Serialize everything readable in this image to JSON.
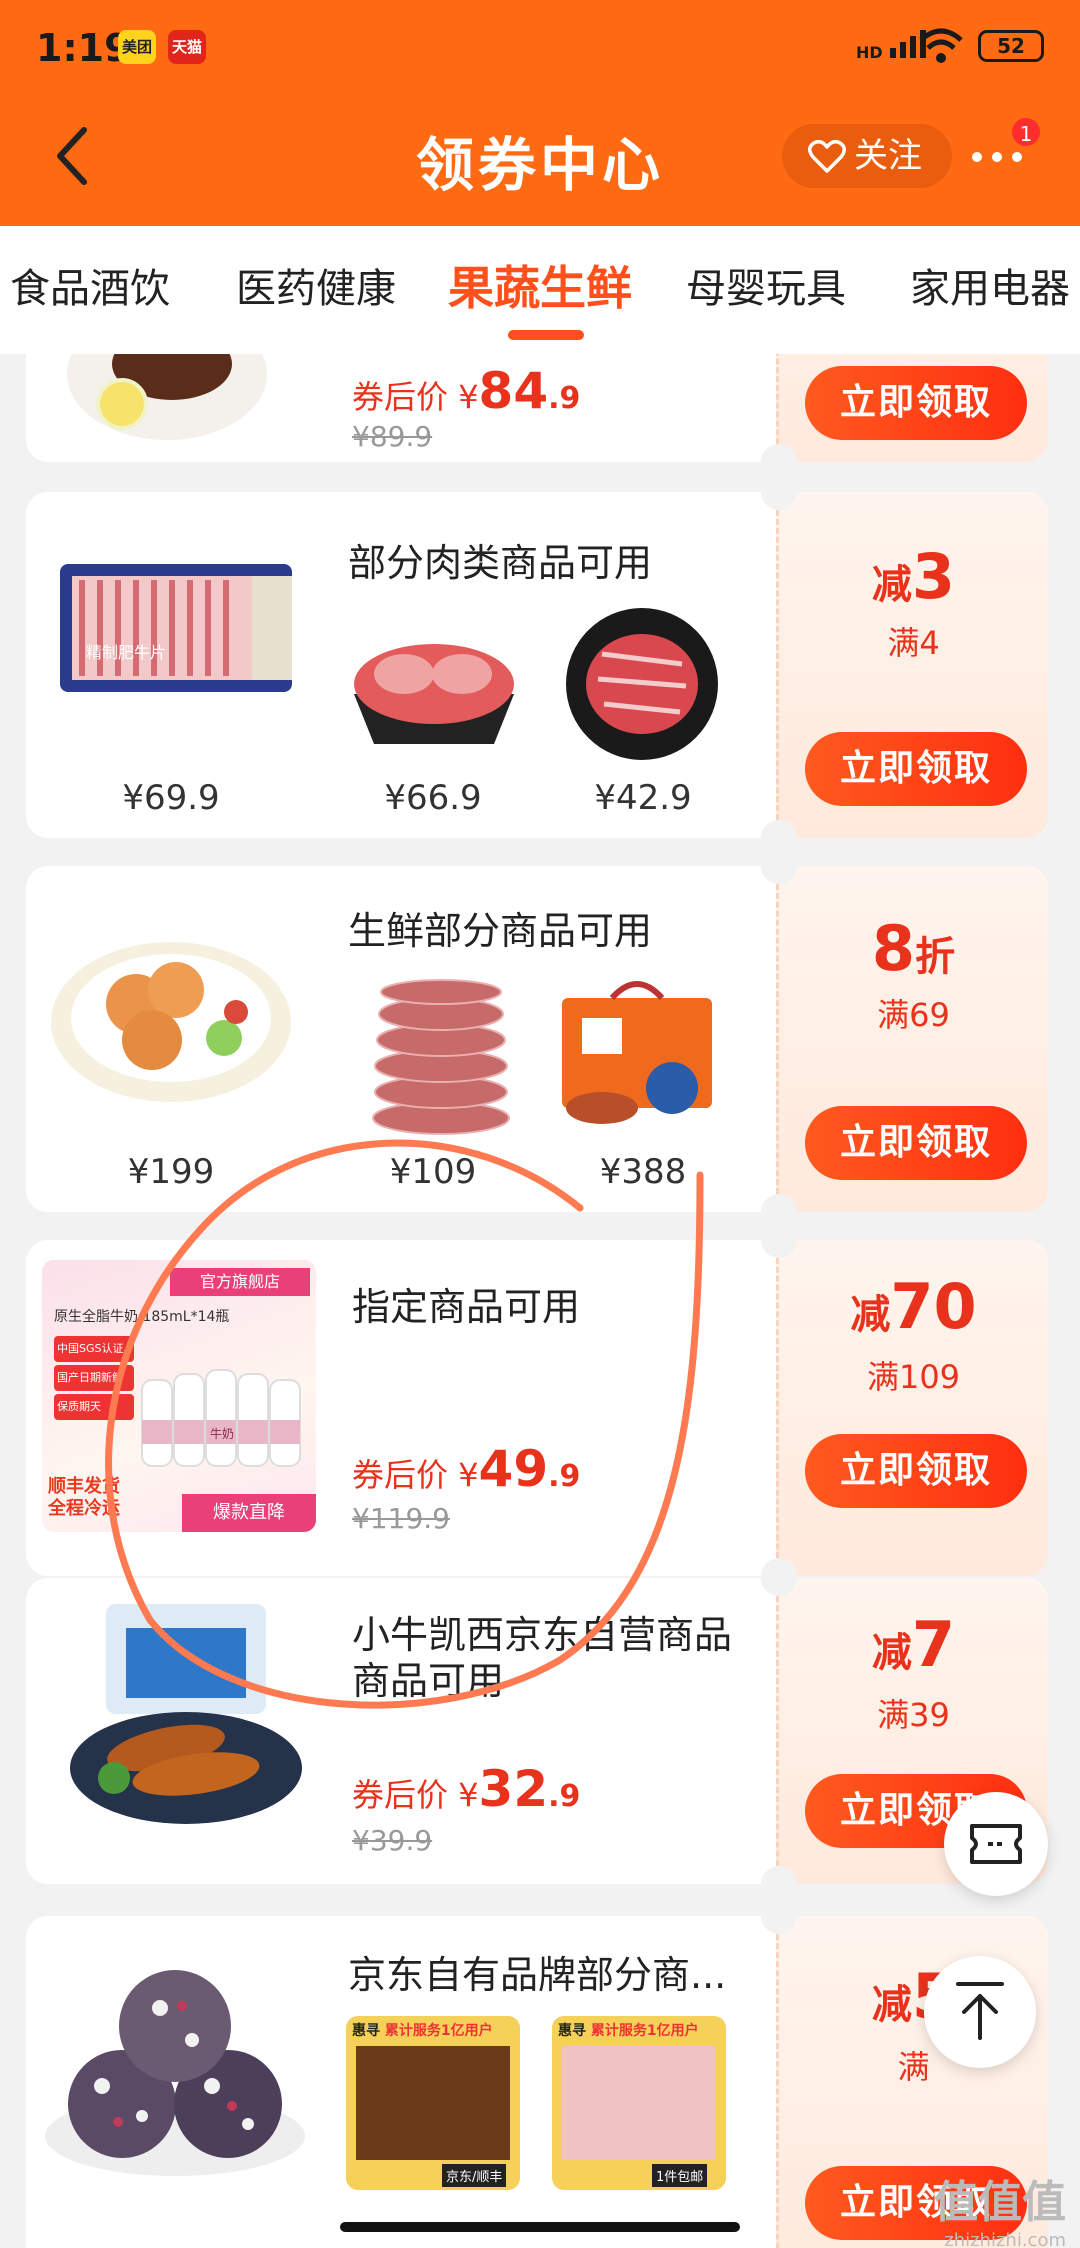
{
  "status_bar": {
    "time": "1:19",
    "app1": "美团",
    "app2": "天猫",
    "network": "HD",
    "battery": "52"
  },
  "nav": {
    "title": "领券中心",
    "follow_label": "关注",
    "badge_count": "1"
  },
  "tabs": [
    "食品酒饮",
    "医药健康",
    "果蔬生鲜",
    "母婴玩具",
    "家用电器"
  ],
  "active_tab": "果蔬生鲜",
  "cards": [
    {
      "after_label": "券后价",
      "currency": "¥",
      "after_int": "84",
      "after_dec": ".9",
      "original": "¥89.9",
      "claim": "立即领取"
    },
    {
      "title": "部分肉类商品可用",
      "prices": [
        "¥69.9",
        "¥66.9",
        "¥42.9"
      ],
      "amount_prefix": "减",
      "amount": "3",
      "condition": "满4",
      "claim": "立即领取",
      "package_text": "精制肥牛片"
    },
    {
      "title": "生鲜部分商品可用",
      "prices": [
        "¥199",
        "¥109",
        "¥388"
      ],
      "amount": "8",
      "amount_suffix": "折",
      "condition": "满69",
      "claim": "立即领取"
    },
    {
      "title": "指定商品可用",
      "after_label": "券后价",
      "currency": "¥",
      "after_int": "49",
      "after_dec": ".9",
      "original": "¥119.9",
      "amount_prefix": "减",
      "amount": "70",
      "condition": "满109",
      "claim": "立即领取",
      "img_texts": {
        "store": "官方旗舰店",
        "product": "原生全脂牛奶 185mL*14瓶",
        "tag1": "中国SGS认证",
        "tag2": "国产日期新鲜",
        "tag3": "保质期天",
        "promo1": "顺丰发货",
        "promo2": "全程冷运",
        "bottom": "爆款直降",
        "bottle": "牛奶"
      }
    },
    {
      "title": "小牛凯西京东自营商品商品可用",
      "after_label": "券后价",
      "currency": "¥",
      "after_int": "32",
      "after_dec": ".9",
      "original": "¥39.9",
      "amount_prefix": "减",
      "amount": "7",
      "condition": "满39",
      "claim": "立即领取"
    },
    {
      "title": "京东自有品牌部分商...",
      "amount_prefix": "减",
      "amount": "5",
      "condition": "满",
      "claim": "立即领取",
      "img_texts": {
        "brand": "惠寻",
        "served": "累计服务1亿用户",
        "tag1": "京东/顺丰",
        "tag2": "1件包邮"
      }
    }
  ],
  "watermark": {
    "main": "值值值",
    "sub": "zhizhizhi.com"
  },
  "colors": {
    "primary": "#ff6a13",
    "accent_red": "#e8321c",
    "claim_btn": "#ff3a14",
    "annotation": "#ff7a50"
  }
}
